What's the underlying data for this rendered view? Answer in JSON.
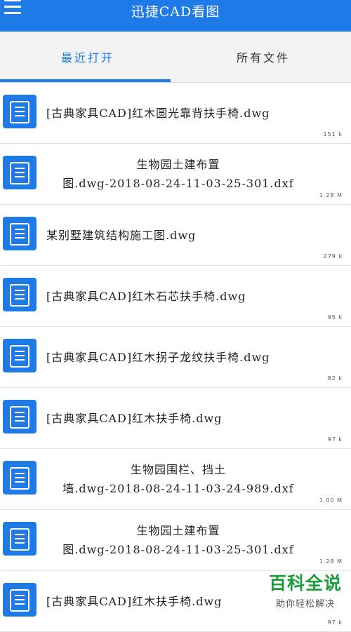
{
  "app": {
    "title": "迅捷CAD看图"
  },
  "tabs": [
    {
      "label": "最近打开",
      "active": true
    },
    {
      "label": "所有文件",
      "active": false
    }
  ],
  "files": [
    {
      "name_lines": [
        "[古典家具CAD]红木圆光靠背扶手椅.dwg"
      ],
      "size": "151 k"
    },
    {
      "name_lines": [
        "生物园土建布置",
        "图.dwg-2018-08-24-11-03-25-301.dxf"
      ],
      "size": "1.28 M"
    },
    {
      "name_lines": [
        "某别墅建筑结构施工图.dwg"
      ],
      "size": "279 k"
    },
    {
      "name_lines": [
        "[古典家具CAD]红木石芯扶手椅.dwg"
      ],
      "size": "95 k"
    },
    {
      "name_lines": [
        "[古典家具CAD]红木拐子龙纹扶手椅.dwg"
      ],
      "size": "82 k"
    },
    {
      "name_lines": [
        "[古典家具CAD]红木扶手椅.dwg"
      ],
      "size": "97 k"
    },
    {
      "name_lines": [
        "生物园围栏、挡土",
        "墙.dwg-2018-08-24-11-03-24-989.dxf"
      ],
      "size": "1.00 M"
    },
    {
      "name_lines": [
        "生物园土建布置",
        "图.dwg-2018-08-24-11-03-25-301.dxf"
      ],
      "size": "1.28 M"
    },
    {
      "name_lines": [
        "[古典家具CAD]红木扶手椅.dwg"
      ],
      "size": "97 k"
    }
  ],
  "watermark": {
    "title": "百科全说",
    "subtitle": "助你轻松解决"
  },
  "colors": {
    "accent": "#1e7ae6",
    "watermark_green": "#1c9b3a"
  },
  "icons": {
    "menu": "hamburger-menu-icon",
    "file": "cad-file-icon"
  }
}
